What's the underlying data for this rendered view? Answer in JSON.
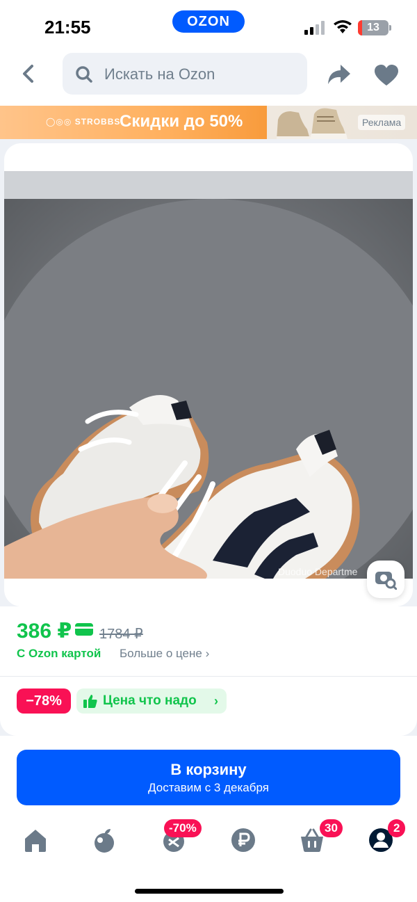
{
  "status": {
    "time": "21:55",
    "brand": "OZON",
    "battery": "13"
  },
  "header": {
    "search_placeholder": "Искать на Ozon"
  },
  "banner": {
    "brand": "◯◎◎ STROBBS",
    "text": "Скидки до 50%",
    "ad_label": "Реклама"
  },
  "product": {
    "watermark": "Duoduo Departme"
  },
  "price": {
    "current": "386 ₽",
    "old": "1784 ₽",
    "with_card": "С Ozon картой",
    "more": "Больше о цене ›",
    "discount": "−78%",
    "good_price": "Цена что надо",
    "good_price_chevron": "›"
  },
  "cart": {
    "label": "В корзину",
    "delivery": "Доставим с 3 декабря"
  },
  "tabbar": {
    "tabs": [
      {
        "name": "home",
        "badge": ""
      },
      {
        "name": "fresh",
        "badge": ""
      },
      {
        "name": "sale",
        "badge": "-70%"
      },
      {
        "name": "finance",
        "badge": ""
      },
      {
        "name": "cart",
        "badge": "30"
      },
      {
        "name": "profile",
        "badge": "2"
      }
    ]
  },
  "colors": {
    "brand": "#005bff",
    "price_green": "#10c44c",
    "discount_pink": "#f91155"
  }
}
